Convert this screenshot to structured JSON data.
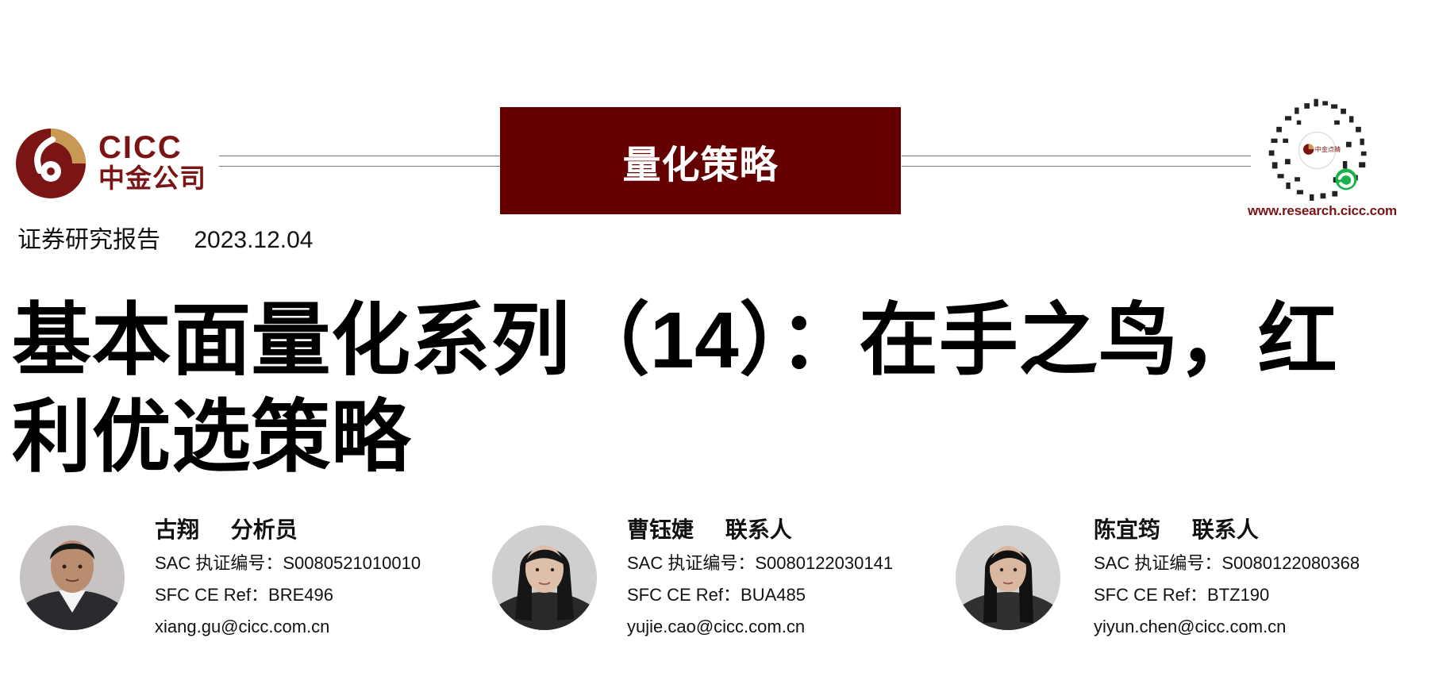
{
  "header": {
    "logo": {
      "icon": "cicc-logo-icon",
      "english_text": "CICC",
      "chinese_text": "中金公司",
      "brand_color": "#7B1414"
    },
    "category": "量化策略",
    "category_color": "#650000",
    "qr_icon": "qr-code-icon",
    "website": "www.research.cicc.com"
  },
  "report": {
    "type": "证券研究报告",
    "date": "2023.12.04",
    "title": "基本面量化系列（14）：在手之鸟，红利优选策略"
  },
  "authors": [
    {
      "name": "古翔",
      "role": "分析员",
      "sac": "SAC 执证编号：S0080521010010",
      "sfc": "SFC CE Ref：BRE496",
      "email": "xiang.gu@cicc.com.cn",
      "avatar_icon": "male-avatar-icon"
    },
    {
      "name": "曹钰婕",
      "role": "联系人",
      "sac": "SAC 执证编号：S0080122030141",
      "sfc": "SFC CE Ref：BUA485",
      "email": "yujie.cao@cicc.com.cn",
      "avatar_icon": "female-avatar-icon"
    },
    {
      "name": "陈宜筠",
      "role": "联系人",
      "sac": "SAC 执证编号：S0080122080368",
      "sfc": "SFC CE Ref：BTZ190",
      "email": "yiyun.chen@cicc.com.cn",
      "avatar_icon": "female-avatar-icon"
    }
  ]
}
